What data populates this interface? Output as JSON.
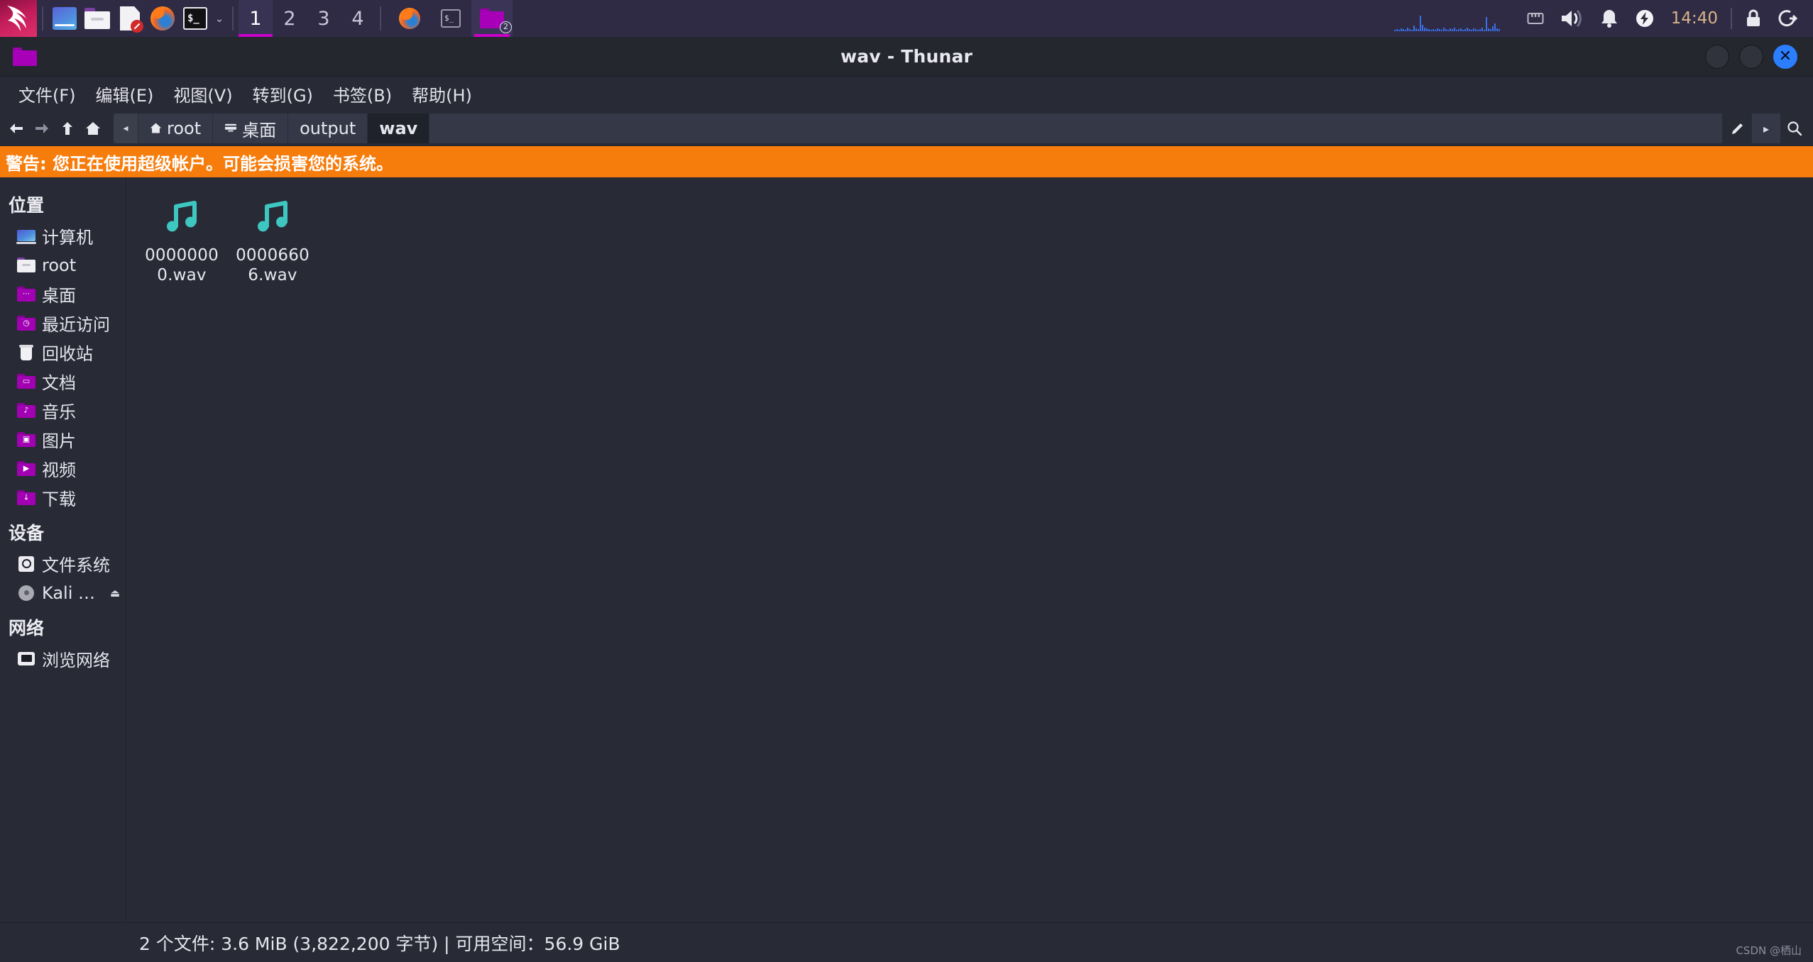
{
  "taskbar": {
    "launchers": [
      {
        "name": "kali-menu",
        "icon": "kali-dragon-icon",
        "label": "Kali"
      },
      {
        "name": "file-manager-launcher",
        "icon": "files-icon",
        "label": "Files"
      },
      {
        "name": "folder-launcher",
        "icon": "folder-icon",
        "label": "Folder"
      },
      {
        "name": "text-editor-launcher",
        "icon": "document-edit-icon",
        "label": "Editor"
      },
      {
        "name": "firefox-launcher",
        "icon": "firefox-icon",
        "label": "Firefox"
      },
      {
        "name": "terminal-launcher",
        "icon": "terminal-icon",
        "label": "Terminal"
      }
    ],
    "launcher_chevron": "⌄",
    "workspaces": [
      {
        "label": "1",
        "active": true
      },
      {
        "label": "2",
        "active": false
      },
      {
        "label": "3",
        "active": false
      },
      {
        "label": "4",
        "active": false
      }
    ],
    "windows": [
      {
        "name": "window-firefox",
        "icon": "firefox-icon",
        "badge": "",
        "active": false
      },
      {
        "name": "window-terminal",
        "icon": "terminal-icon",
        "badge": "",
        "active": false
      },
      {
        "name": "window-thunar",
        "icon": "folder-icon",
        "badge": "2",
        "active": true
      }
    ],
    "tray": {
      "network_graph_label": "network-monitor",
      "ethernet_icon": "ethernet-icon",
      "volume_icon": "volume-icon",
      "notification_icon": "bell-icon",
      "power_icon": "power-bolt-icon",
      "clock": "14:40",
      "lock_icon": "lock-icon",
      "logout_icon": "logout-icon"
    }
  },
  "window": {
    "title": "wav - Thunar",
    "folder_icon": "folder-icon",
    "controls": {
      "minimize": "minimize-button",
      "maximize": "maximize-button",
      "close_glyph": "✕"
    }
  },
  "menubar": {
    "items": [
      {
        "label": "文件(F)"
      },
      {
        "label": "编辑(E)"
      },
      {
        "label": "视图(V)"
      },
      {
        "label": "转到(G)"
      },
      {
        "label": "书签(B)"
      },
      {
        "label": "帮助(H)"
      }
    ]
  },
  "toolbar": {
    "back_glyph": "←",
    "forward_glyph": "→",
    "up_glyph": "↑",
    "home_glyph": "⌂",
    "scroll_left_glyph": "◂",
    "scroll_right_glyph": "▸",
    "edit_path_glyph": "✎",
    "search_glyph": "⌕",
    "breadcrumbs": [
      {
        "label": "root",
        "icon": "home-icon",
        "active": false
      },
      {
        "label": "桌面",
        "icon": "desktop-icon",
        "active": false
      },
      {
        "label": "output",
        "icon": "",
        "active": false
      },
      {
        "label": "wav",
        "icon": "",
        "active": true
      }
    ]
  },
  "warning": {
    "text": "警告: 您正在使用超级帐户。可能会损害您的系统。",
    "color": "#f67c0c"
  },
  "sidebar": {
    "sections": [
      {
        "title": "位置",
        "items": [
          {
            "label": "计算机",
            "icon": "computer-icon"
          },
          {
            "label": "root",
            "icon": "home-folder-icon"
          },
          {
            "label": "桌面",
            "icon": "desktop-folder-icon",
            "glyph": "···"
          },
          {
            "label": "最近访问",
            "icon": "recent-clock-icon",
            "glyph": "◷"
          },
          {
            "label": "回收站",
            "icon": "trash-icon"
          },
          {
            "label": "文档",
            "icon": "documents-folder-icon",
            "glyph": "▭"
          },
          {
            "label": "音乐",
            "icon": "music-folder-icon",
            "glyph": "♪"
          },
          {
            "label": "图片",
            "icon": "pictures-folder-icon",
            "glyph": "▣"
          },
          {
            "label": "视频",
            "icon": "videos-folder-icon",
            "glyph": "▶"
          },
          {
            "label": "下载",
            "icon": "downloads-folder-icon",
            "glyph": "↓"
          }
        ]
      },
      {
        "title": "设备",
        "items": [
          {
            "label": "文件系统",
            "icon": "harddisk-icon"
          },
          {
            "label": "Kali L...",
            "icon": "cdrom-icon",
            "eject": "⏏"
          }
        ]
      },
      {
        "title": "网络",
        "items": [
          {
            "label": "浏览网络",
            "icon": "network-icon"
          }
        ]
      }
    ]
  },
  "fileview": {
    "files": [
      {
        "name": "00000000.wav",
        "icon": "music-note-icon",
        "icon_color": "#3ec6c0"
      },
      {
        "name": "00006606.wav",
        "icon": "music-note-icon",
        "icon_color": "#3ec6c0"
      }
    ]
  },
  "statusbar": {
    "text": "2 个文件: 3.6 MiB (3,822,200 字节) | 可用空间：56.9 GiB"
  },
  "watermark": {
    "text": "CSDN @栖山"
  },
  "colors": {
    "taskbar_bg": "#2f2b44",
    "window_bg": "#282a36",
    "titlebar_bg": "#25272f",
    "accent_magenta": "#c800c8",
    "close_blue": "#2b7fff",
    "warning_orange": "#f67c0c",
    "music_teal": "#3ec6c0"
  }
}
